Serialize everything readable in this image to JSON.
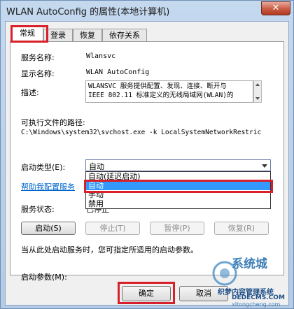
{
  "window": {
    "title": "WLAN AutoConfig 的属性(本地计算机)",
    "close_glyph": "✕"
  },
  "tabs": [
    {
      "label": "常规",
      "active": true
    },
    {
      "label": "登录",
      "active": false
    },
    {
      "label": "恢复",
      "active": false
    },
    {
      "label": "依存关系",
      "active": false
    }
  ],
  "general": {
    "service_name_label": "服务名称:",
    "service_name_value": "Wlansvc",
    "display_name_label": "显示名称:",
    "display_name_value": "WLAN AutoConfig",
    "description_label": "描述:",
    "description_lines": [
      "WLANSVC 服务提供配置、发现、连接、断开与",
      "IEEE 802.11 标准定义的无线局域网(WLAN)的"
    ],
    "exe_path_label": "可执行文件的路径:",
    "exe_path_value": "C:\\Windows\\system32\\svchost.exe -k LocalSystemNetworkRestric",
    "startup_type_label": "启动类型(E):",
    "startup_type_value": "自动",
    "startup_type_options": [
      "自动(延迟启动)",
      "自动",
      "手动",
      "禁用"
    ],
    "startup_type_selected_index": 1,
    "help_link": "帮助我配置服务",
    "service_status_label": "服务状态:",
    "service_status_value": "已停止",
    "buttons": {
      "start": "启动(S)",
      "stop": "停止(T)",
      "pause": "暂停(P)",
      "resume": "恢复(R)"
    },
    "hint_text": "当从此处启动服务时，您可指定所适用的启动参数。",
    "start_params_label": "启动参数(M):",
    "start_params_value": ""
  },
  "dialog_buttons": {
    "ok": "确定",
    "cancel": "取消"
  },
  "watermark": {
    "line1": "系统城",
    "line2": "织梦内容管理系统",
    "line3": "DEDECMS.COM",
    "line4": "xitongcheng.com"
  },
  "colors": {
    "highlight_red": "#d8202a",
    "selection_blue": "#3399ff",
    "link_blue": "#0066cc"
  }
}
